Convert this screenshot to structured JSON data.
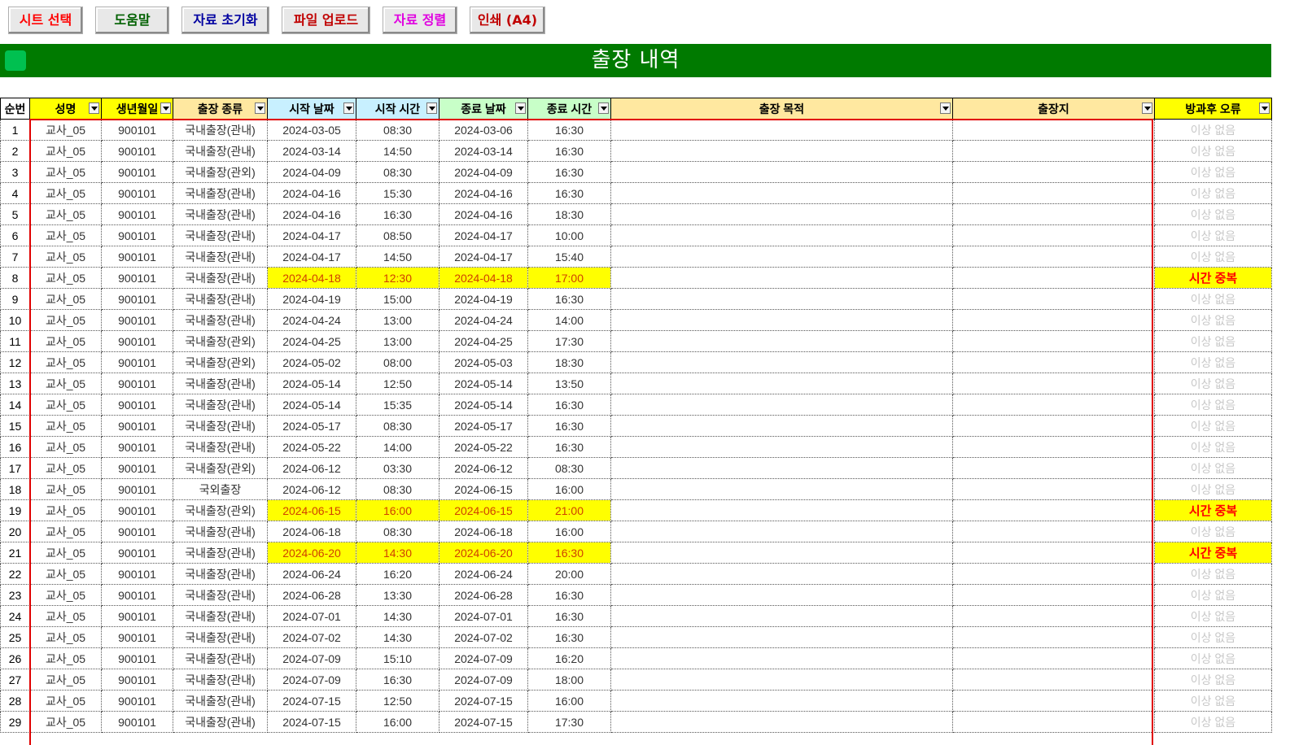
{
  "toolbar": {
    "buttons": [
      {
        "label": "시트 선택",
        "color": "#ff0000"
      },
      {
        "label": "도움말",
        "color": "#006000"
      },
      {
        "label": "자료 초기화",
        "color": "#0000a0"
      },
      {
        "label": "파일 업로드",
        "color": "#c00000"
      },
      {
        "label": "자료 정렬",
        "color": "#e000e0"
      },
      {
        "label": "인쇄 (A4)",
        "color": "#c00000"
      }
    ]
  },
  "banner": {
    "title": "출장 내역",
    "color": "#007a00"
  },
  "table": {
    "headers": [
      {
        "label": "순번",
        "bg": "#ffffff",
        "filter": false
      },
      {
        "label": "성명",
        "bg": "#ffff00",
        "filter": true
      },
      {
        "label": "생년월일",
        "bg": "#ffff00",
        "filter": true
      },
      {
        "label": "출장 종류",
        "bg": "#ffe8a0",
        "filter": true
      },
      {
        "label": "시작 날짜",
        "bg": "#c8f0ff",
        "filter": true
      },
      {
        "label": "시작 시간",
        "bg": "#c8f0ff",
        "filter": true
      },
      {
        "label": "종료 날짜",
        "bg": "#c8ffc8",
        "filter": true
      },
      {
        "label": "종료 시간",
        "bg": "#c8ffc8",
        "filter": true
      },
      {
        "label": "출장 목적",
        "bg": "#ffe8a0",
        "filter": true
      },
      {
        "label": "출장지",
        "bg": "#ffe8a0",
        "filter": true
      },
      {
        "label": "방과후 오류",
        "bg": "#ffff00",
        "filter": true
      }
    ],
    "rows": [
      {
        "no": "1",
        "name": "교사_05",
        "birth": "900101",
        "type": "국내출장(관내)",
        "start_date": "2024-03-05",
        "start_time": "08:30",
        "end_date": "2024-03-06",
        "end_time": "16:30",
        "purpose": "",
        "place": "",
        "error": "이상 없음",
        "flag": false
      },
      {
        "no": "2",
        "name": "교사_05",
        "birth": "900101",
        "type": "국내출장(관내)",
        "start_date": "2024-03-14",
        "start_time": "14:50",
        "end_date": "2024-03-14",
        "end_time": "16:30",
        "purpose": "",
        "place": "",
        "error": "이상 없음",
        "flag": false
      },
      {
        "no": "3",
        "name": "교사_05",
        "birth": "900101",
        "type": "국내출장(관외)",
        "start_date": "2024-04-09",
        "start_time": "08:30",
        "end_date": "2024-04-09",
        "end_time": "16:30",
        "purpose": "",
        "place": "",
        "error": "이상 없음",
        "flag": false
      },
      {
        "no": "4",
        "name": "교사_05",
        "birth": "900101",
        "type": "국내출장(관내)",
        "start_date": "2024-04-16",
        "start_time": "15:30",
        "end_date": "2024-04-16",
        "end_time": "16:30",
        "purpose": "",
        "place": "",
        "error": "이상 없음",
        "flag": false
      },
      {
        "no": "5",
        "name": "교사_05",
        "birth": "900101",
        "type": "국내출장(관내)",
        "start_date": "2024-04-16",
        "start_time": "16:30",
        "end_date": "2024-04-16",
        "end_time": "18:30",
        "purpose": "",
        "place": "",
        "error": "이상 없음",
        "flag": false
      },
      {
        "no": "6",
        "name": "교사_05",
        "birth": "900101",
        "type": "국내출장(관내)",
        "start_date": "2024-04-17",
        "start_time": "08:50",
        "end_date": "2024-04-17",
        "end_time": "10:00",
        "purpose": "",
        "place": "",
        "error": "이상 없음",
        "flag": false
      },
      {
        "no": "7",
        "name": "교사_05",
        "birth": "900101",
        "type": "국내출장(관내)",
        "start_date": "2024-04-17",
        "start_time": "14:50",
        "end_date": "2024-04-17",
        "end_time": "15:40",
        "purpose": "",
        "place": "",
        "error": "이상 없음",
        "flag": false
      },
      {
        "no": "8",
        "name": "교사_05",
        "birth": "900101",
        "type": "국내출장(관내)",
        "start_date": "2024-04-18",
        "start_time": "12:30",
        "end_date": "2024-04-18",
        "end_time": "17:00",
        "purpose": "",
        "place": "",
        "error": "시간 중복",
        "flag": true
      },
      {
        "no": "9",
        "name": "교사_05",
        "birth": "900101",
        "type": "국내출장(관내)",
        "start_date": "2024-04-19",
        "start_time": "15:00",
        "end_date": "2024-04-19",
        "end_time": "16:30",
        "purpose": "",
        "place": "",
        "error": "이상 없음",
        "flag": false
      },
      {
        "no": "10",
        "name": "교사_05",
        "birth": "900101",
        "type": "국내출장(관내)",
        "start_date": "2024-04-24",
        "start_time": "13:00",
        "end_date": "2024-04-24",
        "end_time": "14:00",
        "purpose": "",
        "place": "",
        "error": "이상 없음",
        "flag": false
      },
      {
        "no": "11",
        "name": "교사_05",
        "birth": "900101",
        "type": "국내출장(관외)",
        "start_date": "2024-04-25",
        "start_time": "13:00",
        "end_date": "2024-04-25",
        "end_time": "17:30",
        "purpose": "",
        "place": "",
        "error": "이상 없음",
        "flag": false
      },
      {
        "no": "12",
        "name": "교사_05",
        "birth": "900101",
        "type": "국내출장(관외)",
        "start_date": "2024-05-02",
        "start_time": "08:00",
        "end_date": "2024-05-03",
        "end_time": "18:30",
        "purpose": "",
        "place": "",
        "error": "이상 없음",
        "flag": false
      },
      {
        "no": "13",
        "name": "교사_05",
        "birth": "900101",
        "type": "국내출장(관내)",
        "start_date": "2024-05-14",
        "start_time": "12:50",
        "end_date": "2024-05-14",
        "end_time": "13:50",
        "purpose": "",
        "place": "",
        "error": "이상 없음",
        "flag": false
      },
      {
        "no": "14",
        "name": "교사_05",
        "birth": "900101",
        "type": "국내출장(관내)",
        "start_date": "2024-05-14",
        "start_time": "15:35",
        "end_date": "2024-05-14",
        "end_time": "16:30",
        "purpose": "",
        "place": "",
        "error": "이상 없음",
        "flag": false
      },
      {
        "no": "15",
        "name": "교사_05",
        "birth": "900101",
        "type": "국내출장(관내)",
        "start_date": "2024-05-17",
        "start_time": "08:30",
        "end_date": "2024-05-17",
        "end_time": "16:30",
        "purpose": "",
        "place": "",
        "error": "이상 없음",
        "flag": false
      },
      {
        "no": "16",
        "name": "교사_05",
        "birth": "900101",
        "type": "국내출장(관내)",
        "start_date": "2024-05-22",
        "start_time": "14:00",
        "end_date": "2024-05-22",
        "end_time": "16:30",
        "purpose": "",
        "place": "",
        "error": "이상 없음",
        "flag": false
      },
      {
        "no": "17",
        "name": "교사_05",
        "birth": "900101",
        "type": "국내출장(관외)",
        "start_date": "2024-06-12",
        "start_time": "03:30",
        "end_date": "2024-06-12",
        "end_time": "08:30",
        "purpose": "",
        "place": "",
        "error": "이상 없음",
        "flag": false
      },
      {
        "no": "18",
        "name": "교사_05",
        "birth": "900101",
        "type": "국외출장",
        "start_date": "2024-06-12",
        "start_time": "08:30",
        "end_date": "2024-06-15",
        "end_time": "16:00",
        "purpose": "",
        "place": "",
        "error": "이상 없음",
        "flag": false
      },
      {
        "no": "19",
        "name": "교사_05",
        "birth": "900101",
        "type": "국내출장(관외)",
        "start_date": "2024-06-15",
        "start_time": "16:00",
        "end_date": "2024-06-15",
        "end_time": "21:00",
        "purpose": "",
        "place": "",
        "error": "시간 중복",
        "flag": true
      },
      {
        "no": "20",
        "name": "교사_05",
        "birth": "900101",
        "type": "국내출장(관내)",
        "start_date": "2024-06-18",
        "start_time": "08:30",
        "end_date": "2024-06-18",
        "end_time": "16:00",
        "purpose": "",
        "place": "",
        "error": "이상 없음",
        "flag": false
      },
      {
        "no": "21",
        "name": "교사_05",
        "birth": "900101",
        "type": "국내출장(관내)",
        "start_date": "2024-06-20",
        "start_time": "14:30",
        "end_date": "2024-06-20",
        "end_time": "16:30",
        "purpose": "",
        "place": "",
        "error": "시간 중복",
        "flag": true
      },
      {
        "no": "22",
        "name": "교사_05",
        "birth": "900101",
        "type": "국내출장(관내)",
        "start_date": "2024-06-24",
        "start_time": "16:20",
        "end_date": "2024-06-24",
        "end_time": "20:00",
        "purpose": "",
        "place": "",
        "error": "이상 없음",
        "flag": false
      },
      {
        "no": "23",
        "name": "교사_05",
        "birth": "900101",
        "type": "국내출장(관내)",
        "start_date": "2024-06-28",
        "start_time": "13:30",
        "end_date": "2024-06-28",
        "end_time": "16:30",
        "purpose": "",
        "place": "",
        "error": "이상 없음",
        "flag": false
      },
      {
        "no": "24",
        "name": "교사_05",
        "birth": "900101",
        "type": "국내출장(관내)",
        "start_date": "2024-07-01",
        "start_time": "14:30",
        "end_date": "2024-07-01",
        "end_time": "16:30",
        "purpose": "",
        "place": "",
        "error": "이상 없음",
        "flag": false
      },
      {
        "no": "25",
        "name": "교사_05",
        "birth": "900101",
        "type": "국내출장(관내)",
        "start_date": "2024-07-02",
        "start_time": "14:30",
        "end_date": "2024-07-02",
        "end_time": "16:30",
        "purpose": "",
        "place": "",
        "error": "이상 없음",
        "flag": false
      },
      {
        "no": "26",
        "name": "교사_05",
        "birth": "900101",
        "type": "국내출장(관내)",
        "start_date": "2024-07-09",
        "start_time": "15:10",
        "end_date": "2024-07-09",
        "end_time": "16:20",
        "purpose": "",
        "place": "",
        "error": "이상 없음",
        "flag": false
      },
      {
        "no": "27",
        "name": "교사_05",
        "birth": "900101",
        "type": "국내출장(관내)",
        "start_date": "2024-07-09",
        "start_time": "16:30",
        "end_date": "2024-07-09",
        "end_time": "18:00",
        "purpose": "",
        "place": "",
        "error": "이상 없음",
        "flag": false
      },
      {
        "no": "28",
        "name": "교사_05",
        "birth": "900101",
        "type": "국내출장(관내)",
        "start_date": "2024-07-15",
        "start_time": "12:50",
        "end_date": "2024-07-15",
        "end_time": "16:00",
        "purpose": "",
        "place": "",
        "error": "이상 없음",
        "flag": false
      },
      {
        "no": "29",
        "name": "교사_05",
        "birth": "900101",
        "type": "국내출장(관내)",
        "start_date": "2024-07-15",
        "start_time": "16:00",
        "end_date": "2024-07-15",
        "end_time": "17:30",
        "purpose": "",
        "place": "",
        "error": "이상 없음",
        "flag": false
      }
    ]
  }
}
